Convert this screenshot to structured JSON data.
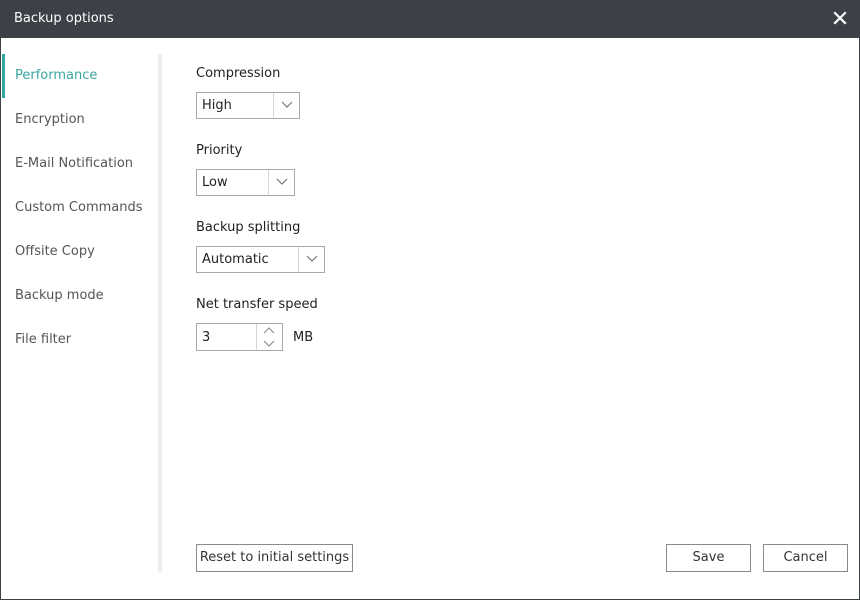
{
  "window": {
    "title": "Backup options",
    "close_icon": "close-icon"
  },
  "sidebar": {
    "items": [
      {
        "label": "Performance",
        "active": true
      },
      {
        "label": "Encryption",
        "active": false
      },
      {
        "label": "E-Mail Notification",
        "active": false
      },
      {
        "label": "Custom Commands",
        "active": false
      },
      {
        "label": "Offsite Copy",
        "active": false
      },
      {
        "label": "Backup mode",
        "active": false
      },
      {
        "label": "File filter",
        "active": false
      }
    ],
    "accent_color": "#3aa6a0"
  },
  "performance": {
    "compression": {
      "label": "Compression",
      "value": "High"
    },
    "priority": {
      "label": "Priority",
      "value": "Low"
    },
    "backup_splitting": {
      "label": "Backup splitting",
      "value": "Automatic"
    },
    "net_transfer_speed": {
      "label": "Net transfer speed",
      "value": "3",
      "unit": "MB"
    }
  },
  "buttons": {
    "reset": "Reset to initial settings",
    "save": "Save",
    "cancel": "Cancel"
  }
}
